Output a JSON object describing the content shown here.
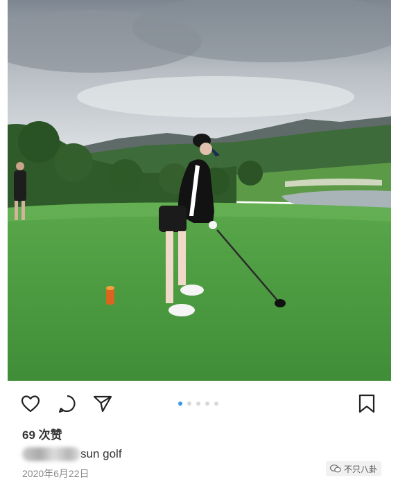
{
  "post": {
    "likes_text": "69 次赞",
    "caption_text": "sun golf",
    "date_text": "2020年6月22日",
    "carousel": {
      "count": 5,
      "active_index": 0
    }
  },
  "actions": {
    "icons": [
      "heart-icon",
      "comment-icon",
      "share-icon",
      "bookmark-icon"
    ]
  },
  "watermark": {
    "text": "不只八卦"
  },
  "colors": {
    "accent": "#3897f0",
    "text": "#333333",
    "muted": "#8a8a8a"
  }
}
